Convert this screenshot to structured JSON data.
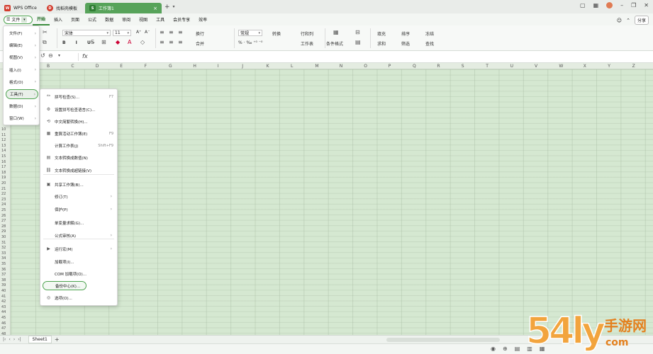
{
  "tabs": {
    "wps": "WPS Office",
    "template": "找稻壳模板",
    "workbook": "工作簿1"
  },
  "menubar": {
    "file": "文件",
    "items": [
      "开始",
      "插入",
      "页面",
      "公式",
      "数据",
      "审阅",
      "视图",
      "工具",
      "会员专享",
      "效率"
    ],
    "share": "分享"
  },
  "ribbon": {
    "font_name": "宋体",
    "font_size": "11",
    "wrap": "换行",
    "merge": "合并",
    "number_format": "常规",
    "convert": "转换",
    "rows_cols": "行和列",
    "worksheet": "工作表",
    "cond_format": "条件格式",
    "fill": "填充",
    "sort": "排序",
    "sum": "求和",
    "filter": "筛选",
    "freeze": "冻结",
    "find": "查找",
    "format_glyphs": "B I U"
  },
  "columns": [
    "B",
    "C",
    "D",
    "E",
    "F",
    "G",
    "H",
    "I",
    "J",
    "K",
    "L",
    "M",
    "N",
    "O",
    "P",
    "Q",
    "R",
    "S",
    "T",
    "U",
    "V",
    "W",
    "X",
    "Y",
    "Z"
  ],
  "rows": [
    "10",
    "11",
    "12",
    "13",
    "14",
    "15",
    "16",
    "17",
    "18",
    "19",
    "20",
    "21",
    "22",
    "23",
    "24",
    "25",
    "26",
    "27",
    "28",
    "29",
    "30",
    "31",
    "32",
    "33",
    "34",
    "35",
    "36",
    "37",
    "38",
    "39",
    "40",
    "41",
    "42",
    "43",
    "44",
    "45",
    "46",
    "47",
    "48"
  ],
  "file_menu": [
    {
      "label": "文件(F)"
    },
    {
      "label": "编辑(E)"
    },
    {
      "label": "视图(V)"
    },
    {
      "label": "插入(I)"
    },
    {
      "label": "格式(O)"
    },
    {
      "label": "工具(T)"
    },
    {
      "label": "数据(D)"
    },
    {
      "label": "窗口(W)"
    }
  ],
  "tools_menu": [
    {
      "label": "拼写检查(S)...",
      "shortcut": "F7",
      "icon": "spellcheck-icon"
    },
    {
      "label": "设置拼写检查语言(C)...",
      "icon": "language-icon"
    },
    {
      "label": "中文简繁转换(H)...",
      "icon": "convert-icon"
    },
    {
      "label": "重算活动工作簿(E)",
      "shortcut": "F9",
      "icon": "recalc-icon"
    },
    {
      "label": "计算工作表(J)",
      "shortcut": "Shift+F9"
    },
    {
      "label": "文本转换成数值(N)",
      "icon": "text-number-icon"
    },
    {
      "label": "文本转换成超链接(V)",
      "icon": "hyperlink-icon"
    },
    {
      "label": "共享工作簿(B)...",
      "icon": "share-workbook-icon"
    },
    {
      "label": "修订(T)"
    },
    {
      "label": "保护(P)"
    },
    {
      "label": "单变量求解(G)..."
    },
    {
      "label": "公式审核(A)"
    },
    {
      "label": "运行宏(M)",
      "icon": "macro-icon"
    },
    {
      "label": "加载项(I)..."
    },
    {
      "label": "COM 加载项(O)..."
    },
    {
      "label": "备份中心(K)..."
    },
    {
      "label": "选项(O)...",
      "icon": "options-icon"
    }
  ],
  "sheet": {
    "name": "Sheet1"
  },
  "watermark": {
    "number": "54ly",
    "cn": "手游网",
    "url": "com"
  }
}
